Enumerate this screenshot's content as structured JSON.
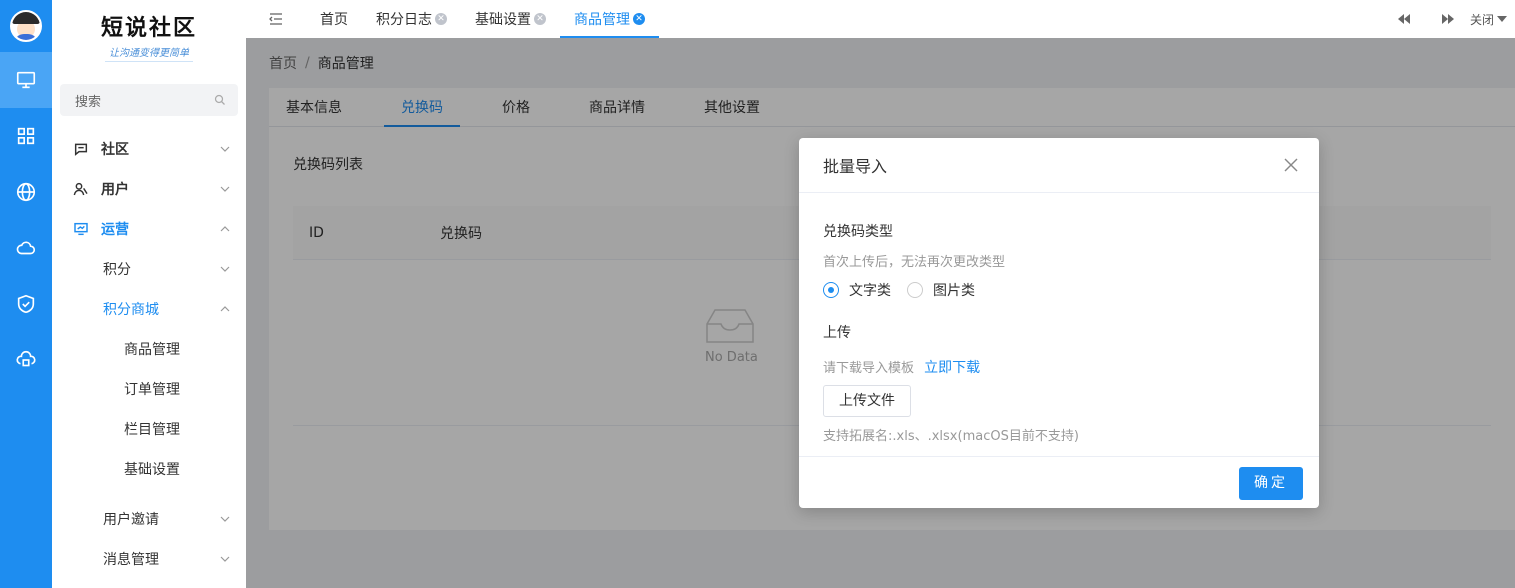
{
  "brand": {
    "title": "短说社区",
    "subtitle": "让沟通变得更简单"
  },
  "search": {
    "placeholder": "搜索"
  },
  "rail": {
    "items": [
      "monitor-icon",
      "grid-icon",
      "globe-icon",
      "cloud-icon",
      "shield-icon",
      "cloud-sync-icon"
    ]
  },
  "menu": {
    "community": "社区",
    "users": "用户",
    "operations": "运营",
    "points": "积分",
    "points_mall": "积分商城",
    "product_mgmt": "商品管理",
    "order_mgmt": "订单管理",
    "column_mgmt": "栏目管理",
    "basic_settings": "基础设置",
    "user_invite": "用户邀请",
    "message_mgmt": "消息管理"
  },
  "tabs": {
    "home": "首页",
    "points_log": "积分日志",
    "basic_settings": "基础设置",
    "product_mgmt": "商品管理",
    "close_label": "关闭"
  },
  "breadcrumb": {
    "home": "首页",
    "current": "商品管理"
  },
  "card_tabs": {
    "basic": "基本信息",
    "codes": "兑换码",
    "price": "价格",
    "detail": "商品详情",
    "other": "其他设置"
  },
  "codes_list": {
    "title": "兑换码列表",
    "col_id": "ID",
    "col_code": "兑换码",
    "empty": "No Data"
  },
  "dialog": {
    "title": "批量导入",
    "code_type_label": "兑换码类型",
    "code_type_hint": "首次上传后，无法再次更改类型",
    "radio_text": "文字类",
    "radio_image": "图片类",
    "upload_label": "上传",
    "template_hint": "请下载导入模板",
    "download_link": "立即下载",
    "upload_button": "上传文件",
    "ext_hint": "支持拓展名:.xls、.xlsx(macOS目前不支持)",
    "confirm": "确定"
  },
  "colors": {
    "accent": "#1e8df0",
    "rail": "#1e8df0"
  }
}
